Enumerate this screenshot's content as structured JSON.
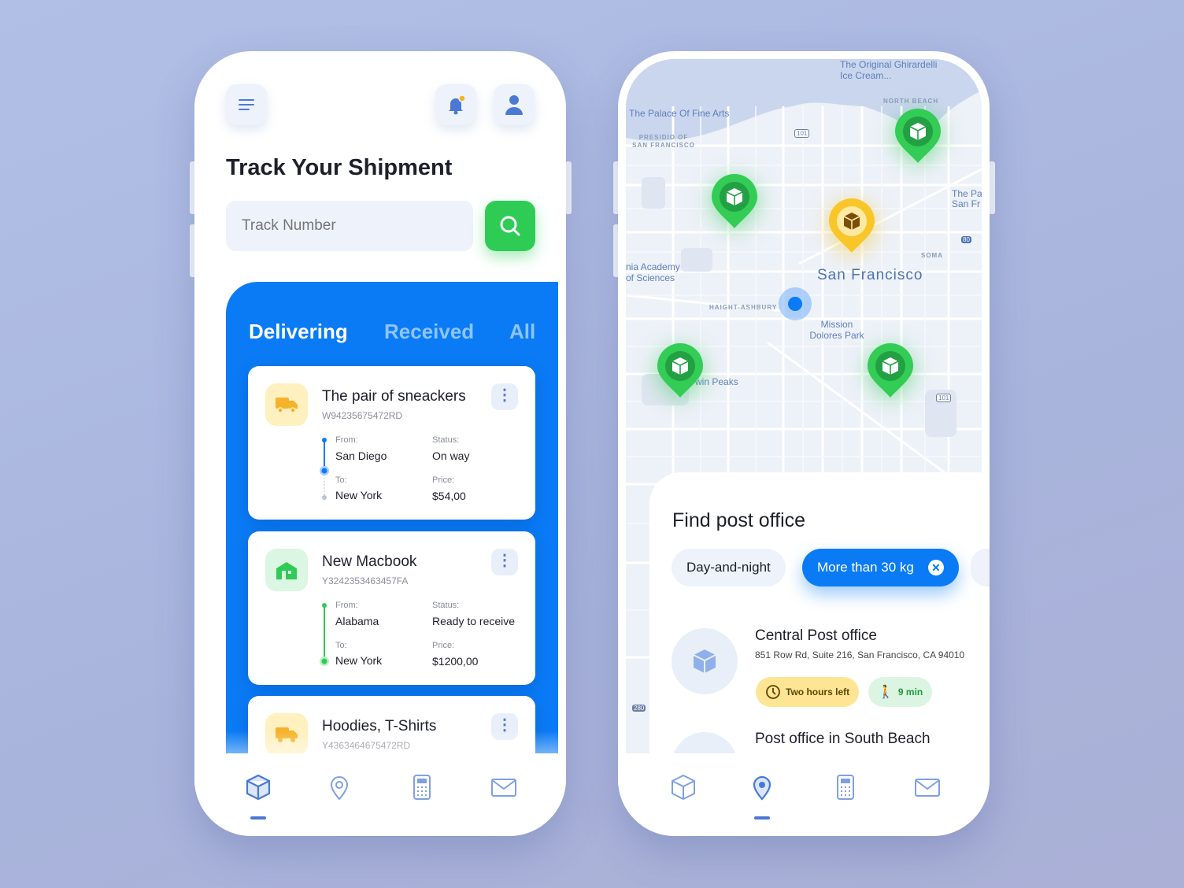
{
  "left_screen": {
    "title": "Track Your Shipment",
    "search": {
      "placeholder": "Track Number"
    },
    "tabs": [
      {
        "label": "Delivering",
        "active": true
      },
      {
        "label": "Received"
      },
      {
        "label": "All"
      }
    ],
    "shipments": [
      {
        "name": "The pair of sneackers",
        "track_id": "W94235675472RD",
        "icon": "truck-icon",
        "icon_color": "#f5b22a",
        "from_label": "From:",
        "from": "San Diego",
        "to_label": "To:",
        "to": "New York",
        "status_label": "Status:",
        "status": "On way",
        "price_label": "Price:",
        "price": "$54,00"
      },
      {
        "name": "New Macbook",
        "track_id": "Y3242353463457FA",
        "icon": "warehouse-icon",
        "icon_color": "#2ecc55",
        "from_label": "From:",
        "from": "Alabama",
        "to_label": "To:",
        "to": "New York",
        "status_label": "Status:",
        "status": "Ready to receive",
        "price_label": "Price:",
        "price": "$1200,00"
      },
      {
        "name": "Hoodies, T-Shirts",
        "track_id": "Y4363464675472RD",
        "icon": "truck-icon",
        "icon_color": "#f5b22a"
      }
    ],
    "nav": {
      "active": "box-icon",
      "items": [
        "box-icon",
        "location-pin-icon",
        "calculator-icon",
        "mail-icon"
      ]
    }
  },
  "right_screen": {
    "map_labels": {
      "ghirardelli": "The Original Ghirardelli Ice Cream...",
      "palace": "The Palace Of Fine Arts",
      "presidio": "PRESIDIO OF SAN FRANCISCO",
      "north_beach": "NORTH BEACH",
      "palace_right": "The Pa San Fr",
      "academy": "nia Academy of Sciences",
      "city": "San Francisco",
      "soma": "SOMA",
      "haight": "HAIGHT-ASHBURY",
      "mission": "Mission Dolores Park",
      "twin_peaks": "win Peaks",
      "hwy101": "101",
      "hwy80": "80",
      "hwy280": "280"
    },
    "sheet_title": "Find post office",
    "filters": [
      {
        "label": "Day-and-night",
        "active": false
      },
      {
        "label": "More than 30 kg",
        "active": true,
        "removable": true
      }
    ],
    "offices": [
      {
        "name": "Central Post office",
        "address": "851 Row Rd, Suite 216, San Francisco, CA 94010",
        "hours_badge": "Two hours left",
        "walk_badge": "9 min"
      },
      {
        "name": "Post office in South Beach"
      }
    ],
    "nav": {
      "active": "location-pin-icon",
      "items": [
        "box-icon",
        "location-pin-icon",
        "calculator-icon",
        "mail-icon"
      ]
    }
  },
  "colors": {
    "primary_blue": "#0a7bf5",
    "green": "#2ecc55",
    "yellow": "#f9c629",
    "background": "#adbae2"
  }
}
